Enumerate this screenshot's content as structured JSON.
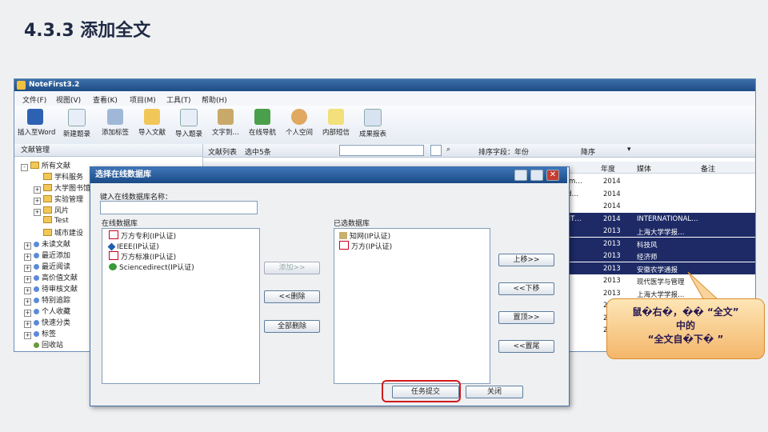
{
  "slide": {
    "title": "4.3.3 添加全文"
  },
  "app": {
    "title": "NoteFirst3.2",
    "menu": [
      "文件(F)",
      "视图(V)",
      "查看(K)",
      "项目(M)",
      "工具(T)",
      "帮助(H)"
    ],
    "toolbar": [
      "插入至Word",
      "新建题录",
      "添加标签",
      "导入文献",
      "导入题录",
      "文字到…",
      "在线导航",
      "个人空间",
      "内部短信",
      "成果报表"
    ],
    "left_panel_title": "文献管理",
    "tree": [
      "所有文献",
      "学科服务",
      "大学图书馆",
      "实验管理",
      "风片",
      "Test",
      "城市建设",
      "未读文献",
      "最近添加",
      "最近阅读",
      "高价值文献",
      "待审核文献",
      "特别追踪",
      "个人收藏",
      "快速分类",
      "标签",
      "回收站"
    ],
    "list_header": {
      "label": "文献列表",
      "selected": "选中5条",
      "sort_label": "排序字段：年份",
      "order": "降序"
    },
    "columns": [
      "年度",
      "媒体",
      "备注"
    ],
    "rows": [
      {
        "left": "a scm…",
        "year": "2014",
        "media": ""
      },
      {
        "left": "cond…",
        "year": "2014",
        "media": ""
      },
      {
        "left": "hy…",
        "year": "2014",
        "media": ""
      },
      {
        "left": "MENT…",
        "year": "2014",
        "media": "INTERNATIONAL…"
      },
      {
        "left": "",
        "year": "2013",
        "media": "上海大学学报…"
      },
      {
        "left": "",
        "year": "2013",
        "media": "科技风"
      },
      {
        "left": "",
        "year": "2013",
        "media": "经济师"
      },
      {
        "left": "",
        "year": "2013",
        "media": "安徽农学通报"
      },
      {
        "left": "",
        "year": "2013",
        "media": "现代医学与管理"
      },
      {
        "left": "",
        "year": "2013",
        "media": "上海大学学报…"
      },
      {
        "left": "",
        "year": "201",
        "media": ""
      },
      {
        "left": "",
        "year": "201",
        "media": ""
      },
      {
        "left": "",
        "year": "201",
        "media": ""
      }
    ]
  },
  "dialog": {
    "title": "选择在线数据库",
    "name_label": "键入在线数据库名称：",
    "online_label": "在线数据库",
    "online": [
      "万方专利(IP认证)",
      "IEEE(IP认证)",
      "万方标准(IP认证)",
      "Sciencedirect(IP认证)"
    ],
    "selected_label": "已选数据库",
    "selected": [
      "知网(IP认证)",
      "万方(IP认证)"
    ],
    "add": "添加>>",
    "remove": "<<删除",
    "remove_all": "全部删除",
    "move_up": "上移>>",
    "move_down": "<<下移",
    "to_top": "置顶>>",
    "to_bottom": "<<置尾",
    "submit": "任务提交",
    "close": "关闭"
  },
  "callout": {
    "line1": "鼠�右�，�� “全文”",
    "line2": "中的",
    "line3": "“全文自�下� ”"
  }
}
